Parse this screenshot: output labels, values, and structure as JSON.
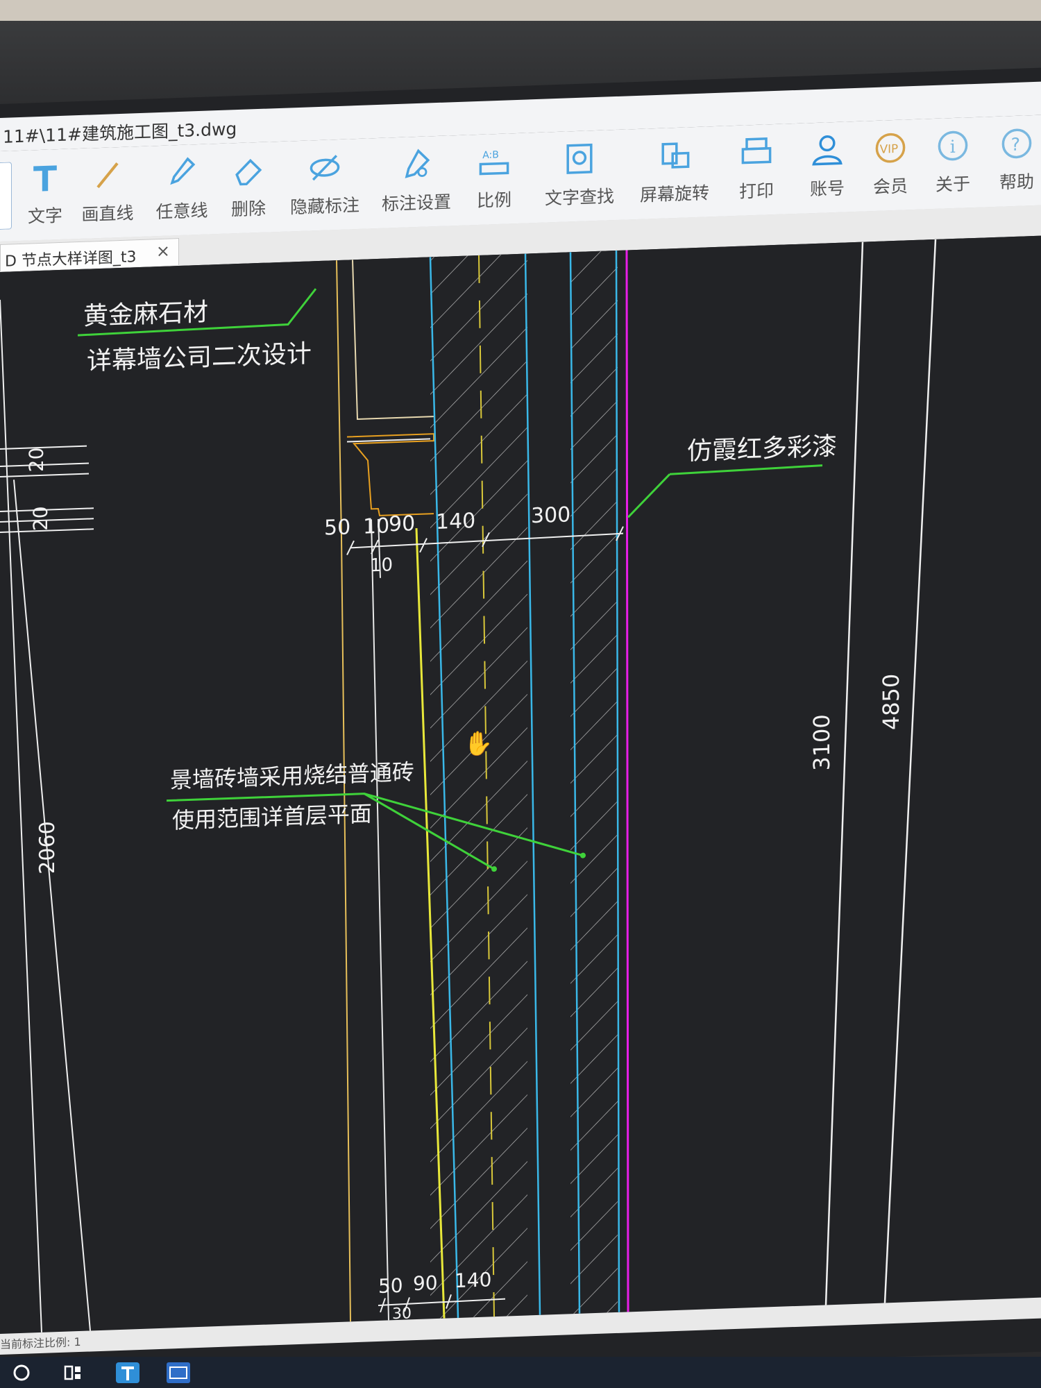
{
  "window": {
    "title": "11#\\11#建筑施工图_t3.dwg"
  },
  "toolbar": {
    "items": [
      {
        "label": "文字",
        "icon": "text-icon"
      },
      {
        "label": "画直线",
        "icon": "line-icon"
      },
      {
        "label": "任意线",
        "icon": "pen-icon"
      },
      {
        "label": "删除",
        "icon": "eraser-icon"
      },
      {
        "label": "隐藏标注",
        "icon": "eye-hidden-icon"
      },
      {
        "label": "标注设置",
        "icon": "settings-icon"
      },
      {
        "label": "比例",
        "icon": "ruler-icon"
      },
      {
        "label": "文字查找",
        "icon": "search-text-icon"
      },
      {
        "label": "屏幕旋转",
        "icon": "rotate-icon"
      },
      {
        "label": "打印",
        "icon": "printer-icon"
      },
      {
        "label": "账号",
        "icon": "user-icon"
      },
      {
        "label": "会员",
        "icon": "vip-icon"
      },
      {
        "label": "关于",
        "icon": "info-icon"
      },
      {
        "label": "帮助",
        "icon": "help-icon"
      }
    ]
  },
  "tab": {
    "label": "D 节点大样详图_t3",
    "close": "×"
  },
  "drawing": {
    "annotations": {
      "stone": "黄金麻石材",
      "curtain_wall": "详幕墙公司二次设计",
      "paint": "仿霞红多彩漆",
      "brick_line1": "景墙砖墙采用烧结普通砖",
      "brick_line2": "使用范围详首层平面"
    },
    "dimensions_top": [
      "50",
      "10",
      "90",
      "140",
      "300"
    ],
    "dimension_top_sub": "10",
    "dimensions_bottom": [
      "50",
      "90",
      "140"
    ],
    "dimension_bottom_sub": "30",
    "left_dims": [
      "20",
      "20"
    ],
    "left_height": "2060",
    "height_3100": "3100",
    "height_4850": "4850"
  },
  "status": {
    "text": "当前标注比例: 1"
  },
  "colors": {
    "canvas": "#222326",
    "leader": "#3fd23a",
    "cyan": "#3ab8e8",
    "yellow": "#e8d13a",
    "magenta": "#e81ee8",
    "orange": "#e8a020"
  }
}
